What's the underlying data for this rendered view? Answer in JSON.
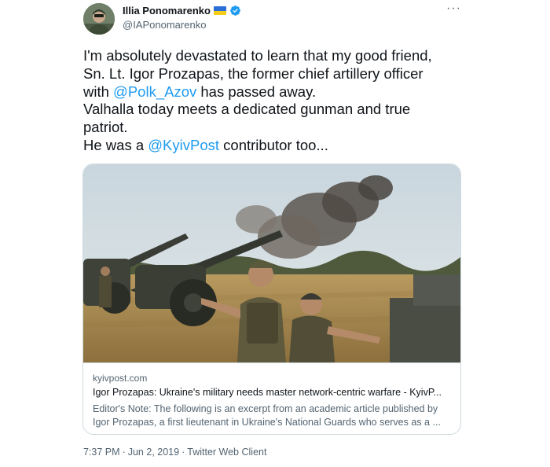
{
  "author": {
    "display_name": "Illia Ponomarenko",
    "handle": "@IAPonomarenko",
    "flag_icon": "ukraine-flag-icon",
    "verified_icon": "verified-badge-icon",
    "verified_color": "#1d9bf0"
  },
  "more_label": "···",
  "tweet": {
    "lines": [
      {
        "text": "I'm absolutely devastated to learn that my good friend,"
      },
      {
        "text": "Sn. Lt. Igor Prozapas, the former chief artillery officer"
      },
      {
        "prefix": "with ",
        "mention": "@Polk_Azov",
        "suffix": " has passed away."
      },
      {
        "text": "Valhalla today meets a dedicated gunman and true"
      },
      {
        "text": "patriot."
      },
      {
        "prefix": "He was a ",
        "mention": "@KyivPost",
        "suffix": " contributor too..."
      }
    ]
  },
  "card": {
    "image_alt": "artillery-crew-photo",
    "domain": "kyivpost.com",
    "title": "Igor Prozapas: Ukraine's military needs master network-centric warfare - KyivP...",
    "description_line1": "Editor's Note: The following is an excerpt from an academic article published by",
    "description_line2": "Igor Prozapas, a first lieutenant in Ukraine's National Guards who serves as a ..."
  },
  "meta": {
    "time": "7:37 PM",
    "separator": "·",
    "date": "Jun 2, 2019",
    "client": "Twitter Web Client"
  },
  "colors": {
    "link": "#1d9bf0",
    "secondary_text": "#536471",
    "border": "#cfd9de"
  }
}
